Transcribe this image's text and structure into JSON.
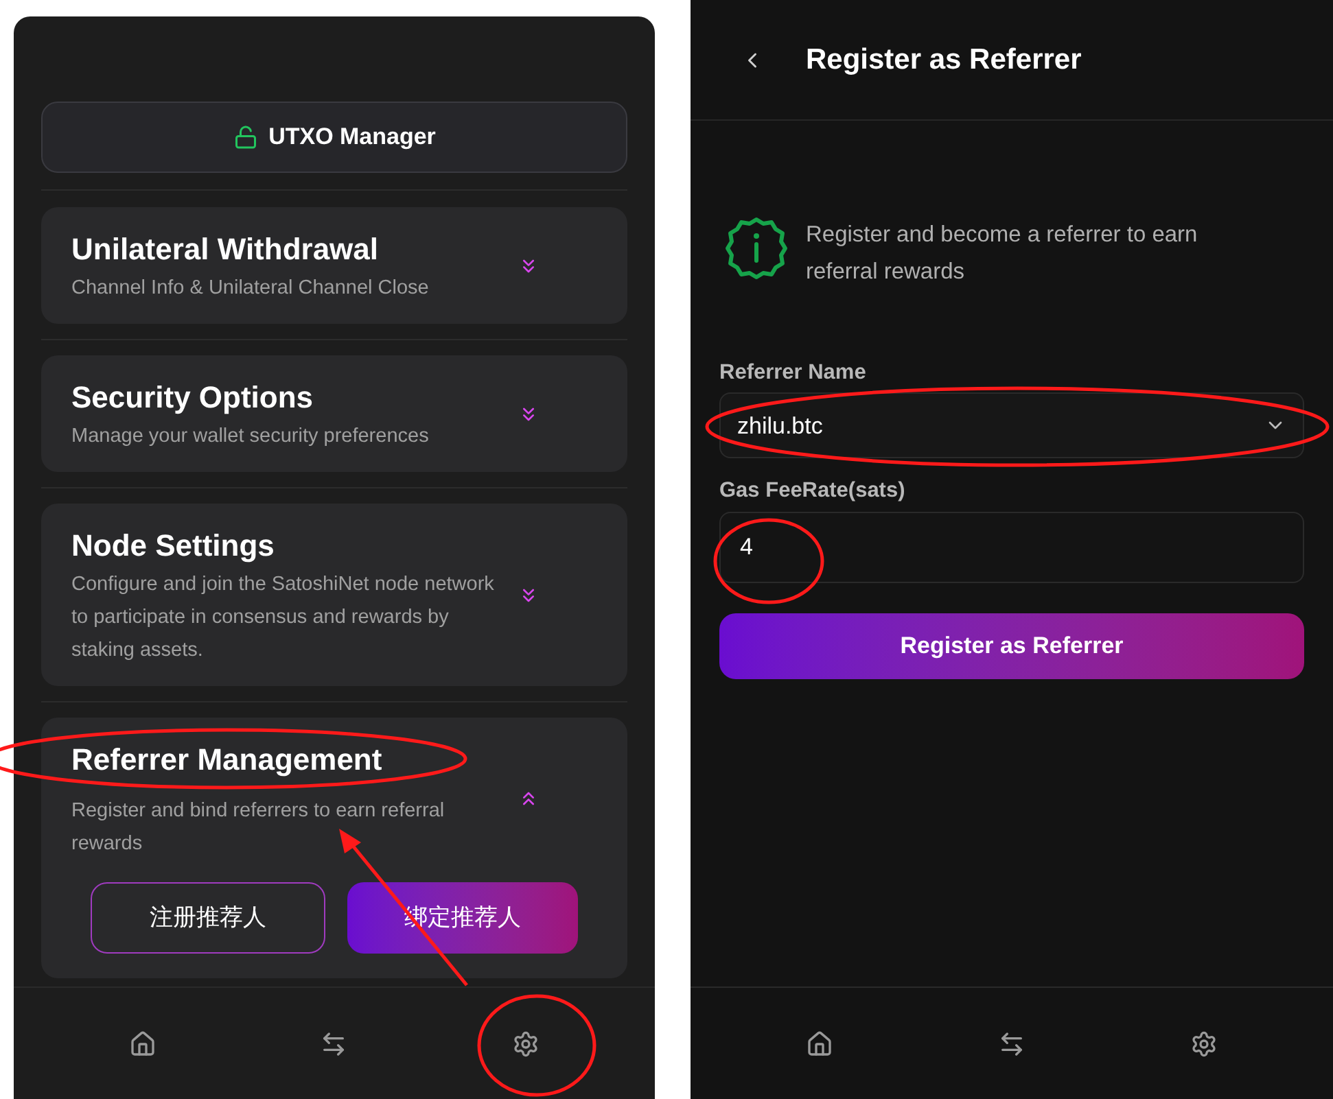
{
  "settings_screen": {
    "utxo_button": "UTXO Manager",
    "sections": [
      {
        "title": "Unilateral Withdrawal",
        "subtitle": "Channel Info & Unilateral Channel Close",
        "expanded": false
      },
      {
        "title": "Security Options",
        "subtitle": "Manage your wallet security preferences",
        "expanded": false
      },
      {
        "title": "Node Settings",
        "subtitle": "Configure and join the SatoshiNet node network to participate in consensus and rewards by staking assets.",
        "expanded": false
      },
      {
        "title": "Referrer Management",
        "subtitle": "Register and bind referrers to earn referral rewards",
        "expanded": true,
        "buttons": [
          {
            "label": "注册推荐人",
            "kind": "outline"
          },
          {
            "label": "绑定推荐人",
            "kind": "filled"
          }
        ]
      }
    ]
  },
  "register_screen": {
    "title": "Register as Referrer",
    "info": "Register and become a referrer to earn referral rewards",
    "fields": [
      {
        "kind": "select",
        "label": "Referrer Name",
        "value": "zhilu.btc"
      },
      {
        "kind": "input",
        "label": "Gas FeeRate(sats)",
        "value": "4"
      }
    ],
    "submit": "Register as Referrer"
  }
}
